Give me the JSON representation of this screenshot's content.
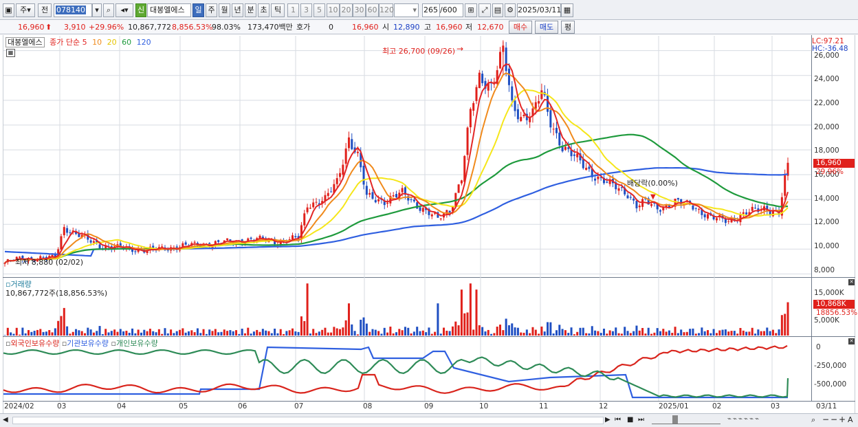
{
  "toolbar": {
    "stock_code": "078140",
    "period_tabs": [
      "일",
      "주",
      "월",
      "년",
      "분",
      "초",
      "틱"
    ],
    "intervals": [
      "1",
      "3",
      "5",
      "10",
      "20",
      "30",
      "60",
      "120"
    ],
    "count": "265",
    "count_total": "/600",
    "date": "2025/03/11",
    "left_labels": [
      "주",
      "전"
    ],
    "badge": "신",
    "stock_name": "대봉엘에스"
  },
  "quote": {
    "price": "16,960",
    "change": "3,910",
    "change_pct": "+29.96%",
    "volume": "10,867,772",
    "volume_pct": "8,856.53%",
    "ratio": "98.03%",
    "amount": "173,470백만",
    "hoga_label": "호가",
    "hoga_value": "0",
    "hoga_price": "16,960",
    "open_label": "시",
    "open": "12,890",
    "high_label": "고",
    "high": "16,960",
    "low_label": "저",
    "low": "12,670",
    "buy_label": "매수",
    "sell_label": "매도",
    "eval_label": "평"
  },
  "price_panel": {
    "name": "대봉엘에스",
    "ma_label": "종가 단순",
    "ma_periods": [
      "5",
      "10",
      "20",
      "60",
      "120"
    ],
    "high_annotation": "최고 26,700 (09/26)",
    "low_annotation": "최저 8,880 (02/02)",
    "dividend_annotation": "배당락(0.00%)",
    "lc": "LC:97.21",
    "hc": "HC:-36.48",
    "current_price_tag": "16,960",
    "current_pct_tag": "29.96%",
    "y_ticks": [
      "26,000",
      "24,000",
      "22,000",
      "20,000",
      "18,000",
      "16,000",
      "14,000",
      "12,000",
      "10,000",
      "8,000"
    ]
  },
  "volume_panel": {
    "title": "거래량",
    "value_text": "10,867,772주(18,856.53%)",
    "y_ticks": [
      "15,000K",
      "10,000K",
      "5,000K"
    ],
    "current_tag": "10,868K",
    "current_pct": "18856.53%"
  },
  "holding_panel": {
    "series": [
      "외국인보유수량",
      "기관보유수량",
      "개인보유수량"
    ],
    "y_ticks": [
      "0",
      "-250,000",
      "-500,000"
    ]
  },
  "x_axis": [
    "2024/02",
    "03",
    "04",
    "05",
    "06",
    "07",
    "08",
    "09",
    "10",
    "11",
    "12",
    "2025/01",
    "02",
    "03",
    "03/11"
  ],
  "colors": {
    "up": "#e0201b",
    "down": "#1f4fc2",
    "ma5": "#e32626",
    "ma10": "#f08a1c",
    "ma20": "#f5e61a",
    "ma60": "#1e9a3c",
    "ma120": "#2f5fe0",
    "foreign": "#d9241c",
    "institution": "#2f5fe0",
    "individual": "#2e8b57"
  },
  "chart_data": {
    "type": "candlestick",
    "x_range": [
      "2024/02",
      "2025/03/11"
    ],
    "ylim": [
      8000,
      27000
    ],
    "price_anchor_points": [
      {
        "x": "2024/02/02",
        "y": 8880
      },
      {
        "x": "2024/03",
        "y": 11500
      },
      {
        "x": "2024/04",
        "y": 9900
      },
      {
        "x": "2024/05",
        "y": 10300
      },
      {
        "x": "2024/06",
        "y": 10600
      },
      {
        "x": "2024/07",
        "y": 11000
      },
      {
        "x": "2024/07 end",
        "y": 18500
      },
      {
        "x": "2024/08",
        "y": 13800
      },
      {
        "x": "2024/09",
        "y": 12200
      },
      {
        "x": "2024/09/26",
        "y": 26700
      },
      {
        "x": "2024/10",
        "y": 20800
      },
      {
        "x": "2024/11",
        "y": 15000
      },
      {
        "x": "2024/12",
        "y": 13500
      },
      {
        "x": "2025/01",
        "y": 13600
      },
      {
        "x": "2025/02",
        "y": 12500
      },
      {
        "x": "2025/03/11",
        "y": 16960
      }
    ],
    "ma120_anchor_points": [
      {
        "x": "2024/02",
        "y": 9800
      },
      {
        "x": "2024/07",
        "y": 10000
      },
      {
        "x": "2024/09",
        "y": 11800
      },
      {
        "x": "2024/11",
        "y": 15000
      },
      {
        "x": "2024/12",
        "y": 16200
      },
      {
        "x": "2025/03",
        "y": 15900
      }
    ],
    "volume_max_K": 17500
  }
}
